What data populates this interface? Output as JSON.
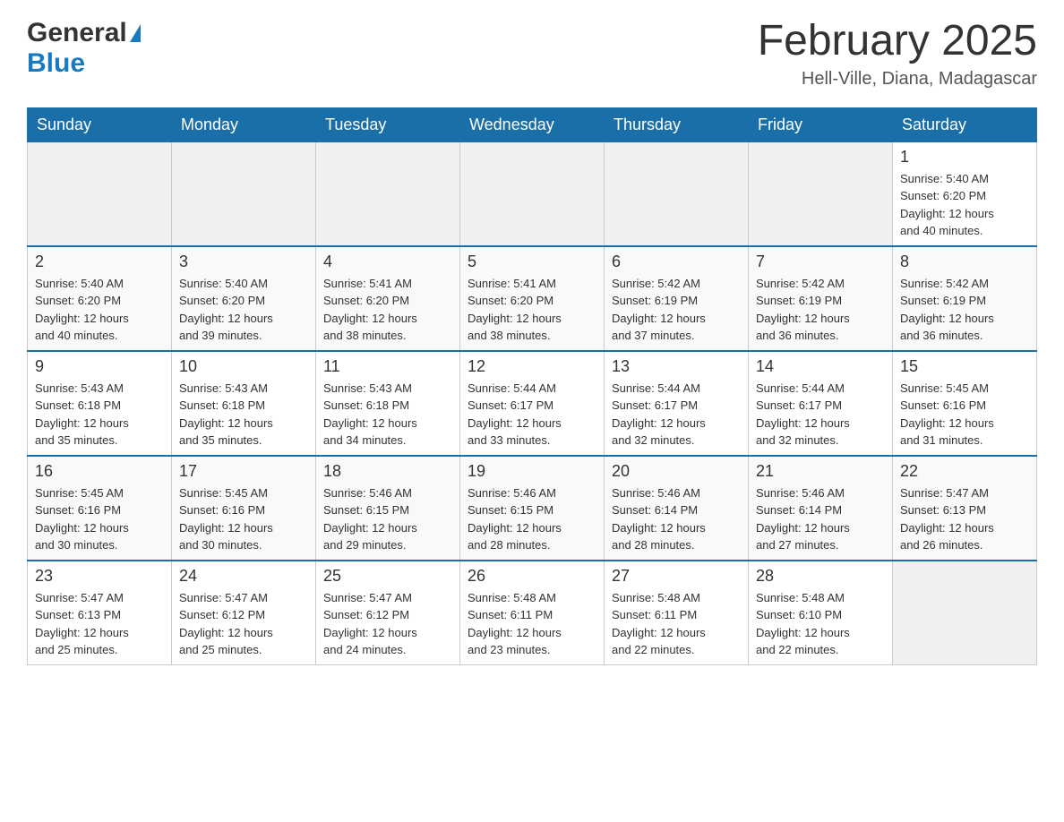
{
  "header": {
    "logo_general": "General",
    "logo_blue": "Blue",
    "month_title": "February 2025",
    "location": "Hell-Ville, Diana, Madagascar"
  },
  "calendar": {
    "days_of_week": [
      "Sunday",
      "Monday",
      "Tuesday",
      "Wednesday",
      "Thursday",
      "Friday",
      "Saturday"
    ],
    "weeks": [
      {
        "days": [
          {
            "number": "",
            "info": "",
            "empty": true
          },
          {
            "number": "",
            "info": "",
            "empty": true
          },
          {
            "number": "",
            "info": "",
            "empty": true
          },
          {
            "number": "",
            "info": "",
            "empty": true
          },
          {
            "number": "",
            "info": "",
            "empty": true
          },
          {
            "number": "",
            "info": "",
            "empty": true
          },
          {
            "number": "1",
            "info": "Sunrise: 5:40 AM\nSunset: 6:20 PM\nDaylight: 12 hours\nand 40 minutes.",
            "empty": false
          }
        ]
      },
      {
        "days": [
          {
            "number": "2",
            "info": "Sunrise: 5:40 AM\nSunset: 6:20 PM\nDaylight: 12 hours\nand 40 minutes.",
            "empty": false
          },
          {
            "number": "3",
            "info": "Sunrise: 5:40 AM\nSunset: 6:20 PM\nDaylight: 12 hours\nand 39 minutes.",
            "empty": false
          },
          {
            "number": "4",
            "info": "Sunrise: 5:41 AM\nSunset: 6:20 PM\nDaylight: 12 hours\nand 38 minutes.",
            "empty": false
          },
          {
            "number": "5",
            "info": "Sunrise: 5:41 AM\nSunset: 6:20 PM\nDaylight: 12 hours\nand 38 minutes.",
            "empty": false
          },
          {
            "number": "6",
            "info": "Sunrise: 5:42 AM\nSunset: 6:19 PM\nDaylight: 12 hours\nand 37 minutes.",
            "empty": false
          },
          {
            "number": "7",
            "info": "Sunrise: 5:42 AM\nSunset: 6:19 PM\nDaylight: 12 hours\nand 36 minutes.",
            "empty": false
          },
          {
            "number": "8",
            "info": "Sunrise: 5:42 AM\nSunset: 6:19 PM\nDaylight: 12 hours\nand 36 minutes.",
            "empty": false
          }
        ]
      },
      {
        "days": [
          {
            "number": "9",
            "info": "Sunrise: 5:43 AM\nSunset: 6:18 PM\nDaylight: 12 hours\nand 35 minutes.",
            "empty": false
          },
          {
            "number": "10",
            "info": "Sunrise: 5:43 AM\nSunset: 6:18 PM\nDaylight: 12 hours\nand 35 minutes.",
            "empty": false
          },
          {
            "number": "11",
            "info": "Sunrise: 5:43 AM\nSunset: 6:18 PM\nDaylight: 12 hours\nand 34 minutes.",
            "empty": false
          },
          {
            "number": "12",
            "info": "Sunrise: 5:44 AM\nSunset: 6:17 PM\nDaylight: 12 hours\nand 33 minutes.",
            "empty": false
          },
          {
            "number": "13",
            "info": "Sunrise: 5:44 AM\nSunset: 6:17 PM\nDaylight: 12 hours\nand 32 minutes.",
            "empty": false
          },
          {
            "number": "14",
            "info": "Sunrise: 5:44 AM\nSunset: 6:17 PM\nDaylight: 12 hours\nand 32 minutes.",
            "empty": false
          },
          {
            "number": "15",
            "info": "Sunrise: 5:45 AM\nSunset: 6:16 PM\nDaylight: 12 hours\nand 31 minutes.",
            "empty": false
          }
        ]
      },
      {
        "days": [
          {
            "number": "16",
            "info": "Sunrise: 5:45 AM\nSunset: 6:16 PM\nDaylight: 12 hours\nand 30 minutes.",
            "empty": false
          },
          {
            "number": "17",
            "info": "Sunrise: 5:45 AM\nSunset: 6:16 PM\nDaylight: 12 hours\nand 30 minutes.",
            "empty": false
          },
          {
            "number": "18",
            "info": "Sunrise: 5:46 AM\nSunset: 6:15 PM\nDaylight: 12 hours\nand 29 minutes.",
            "empty": false
          },
          {
            "number": "19",
            "info": "Sunrise: 5:46 AM\nSunset: 6:15 PM\nDaylight: 12 hours\nand 28 minutes.",
            "empty": false
          },
          {
            "number": "20",
            "info": "Sunrise: 5:46 AM\nSunset: 6:14 PM\nDaylight: 12 hours\nand 28 minutes.",
            "empty": false
          },
          {
            "number": "21",
            "info": "Sunrise: 5:46 AM\nSunset: 6:14 PM\nDaylight: 12 hours\nand 27 minutes.",
            "empty": false
          },
          {
            "number": "22",
            "info": "Sunrise: 5:47 AM\nSunset: 6:13 PM\nDaylight: 12 hours\nand 26 minutes.",
            "empty": false
          }
        ]
      },
      {
        "days": [
          {
            "number": "23",
            "info": "Sunrise: 5:47 AM\nSunset: 6:13 PM\nDaylight: 12 hours\nand 25 minutes.",
            "empty": false
          },
          {
            "number": "24",
            "info": "Sunrise: 5:47 AM\nSunset: 6:12 PM\nDaylight: 12 hours\nand 25 minutes.",
            "empty": false
          },
          {
            "number": "25",
            "info": "Sunrise: 5:47 AM\nSunset: 6:12 PM\nDaylight: 12 hours\nand 24 minutes.",
            "empty": false
          },
          {
            "number": "26",
            "info": "Sunrise: 5:48 AM\nSunset: 6:11 PM\nDaylight: 12 hours\nand 23 minutes.",
            "empty": false
          },
          {
            "number": "27",
            "info": "Sunrise: 5:48 AM\nSunset: 6:11 PM\nDaylight: 12 hours\nand 22 minutes.",
            "empty": false
          },
          {
            "number": "28",
            "info": "Sunrise: 5:48 AM\nSunset: 6:10 PM\nDaylight: 12 hours\nand 22 minutes.",
            "empty": false
          },
          {
            "number": "",
            "info": "",
            "empty": true
          }
        ]
      }
    ]
  }
}
